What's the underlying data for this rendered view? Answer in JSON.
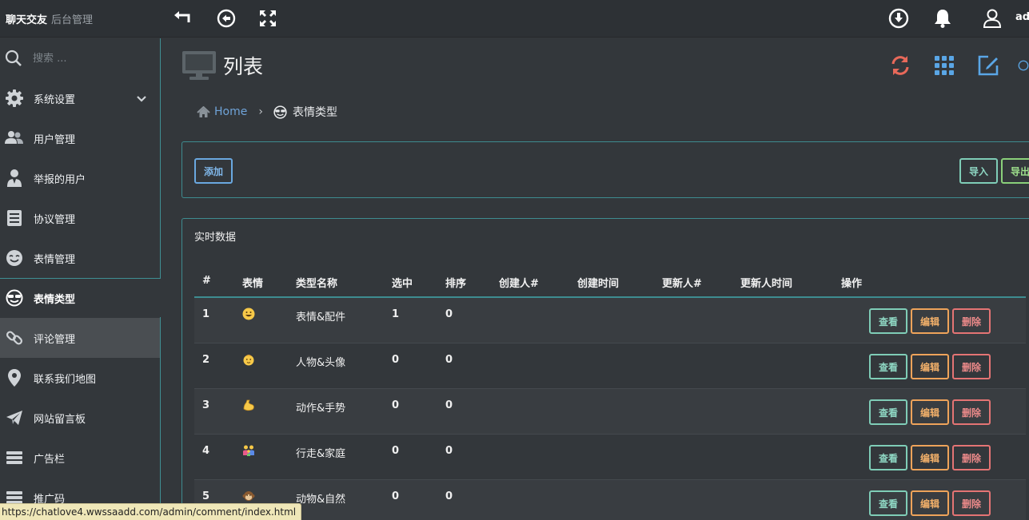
{
  "topbar": {
    "brand_main": "聊天交友",
    "brand_sub": "后台管理",
    "user": "admin"
  },
  "sidebar": {
    "search_placeholder": "搜索 ...",
    "items": [
      {
        "label": "系统设置",
        "icon": "gear-icon"
      },
      {
        "label": "用户管理",
        "icon": "users-icon"
      },
      {
        "label": "举报的用户",
        "icon": "user-report-icon"
      },
      {
        "label": "协议管理",
        "icon": "document-icon"
      },
      {
        "label": "表情管理",
        "icon": "smile-icon"
      },
      {
        "label": "表情类型",
        "icon": "sunglasses-smile-icon"
      },
      {
        "label": "评论管理",
        "icon": "link-icon"
      },
      {
        "label": "联系我们地图",
        "icon": "map-marker-icon"
      },
      {
        "label": "网站留言板",
        "icon": "paper-plane-icon"
      },
      {
        "label": "广告栏",
        "icon": "stack-icon"
      },
      {
        "label": "推广码",
        "icon": "stack-icon"
      }
    ]
  },
  "page": {
    "title": "列表",
    "breadcrumb": {
      "home": "Home",
      "current": "表情类型"
    }
  },
  "toolbar": {
    "add": "添加",
    "import": "导入",
    "export": "导出"
  },
  "table": {
    "title": "实时数据",
    "columns": [
      "#",
      "表情",
      "类型名称",
      "选中",
      "排序",
      "创建人#",
      "创建时间",
      "更新人#",
      "更新人时间",
      "操作"
    ],
    "rows": [
      {
        "id": "1",
        "emoji": "grinning-face",
        "name": "表情&配件",
        "selected": "1",
        "sort": "0"
      },
      {
        "id": "2",
        "emoji": "baby-face",
        "name": "人物&头像",
        "selected": "0",
        "sort": "0"
      },
      {
        "id": "3",
        "emoji": "flexed-biceps",
        "name": "动作&手势",
        "selected": "0",
        "sort": "0"
      },
      {
        "id": "4",
        "emoji": "family",
        "name": "行走&家庭",
        "selected": "0",
        "sort": "0"
      },
      {
        "id": "5",
        "emoji": "monkey-face",
        "name": "动物&自然",
        "selected": "0",
        "sort": "0"
      }
    ],
    "actions": {
      "view": "查看",
      "edit": "编辑",
      "delete": "删除"
    }
  },
  "statusbar": {
    "url": "https://chatlove4.wwssaadd.com/admin/comment/index.html"
  },
  "colors": {
    "accent_teal": "#3e8c90",
    "link_blue": "#6fa3d8",
    "refresh_red": "#e8695a",
    "icon_blue": "#5aa6e6"
  }
}
